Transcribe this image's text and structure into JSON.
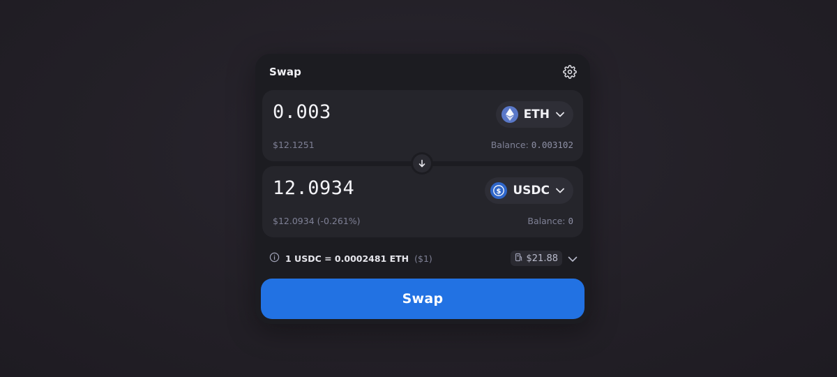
{
  "widget": {
    "title": "Swap",
    "settings_icon": "gear-icon"
  },
  "from": {
    "amount": "0.003",
    "usd_value": "$12.1251",
    "token": "ETH",
    "token_icon": "eth-icon",
    "balance_label": "Balance:",
    "balance_value": "0.003102"
  },
  "switch": {
    "icon": "arrow-down-icon"
  },
  "to": {
    "amount": "12.0934",
    "usd_value": "$12.0934 (-0.261%)",
    "token": "USDC",
    "token_icon": "usdc-icon",
    "balance_label": "Balance:",
    "balance_value": "0"
  },
  "rate": {
    "text": "1 USDC = 0.0002481 ETH",
    "usd": "($1)",
    "info_icon": "info-icon"
  },
  "gas": {
    "icon": "gas-pump-icon",
    "value": "$21.88",
    "expand_icon": "chevron-down-icon"
  },
  "action": {
    "label": "Swap",
    "color": "#2272e3"
  },
  "colors": {
    "background": "#232027",
    "card": "#1c1c21",
    "panel": "#25252b",
    "muted_text": "#7f8196"
  }
}
